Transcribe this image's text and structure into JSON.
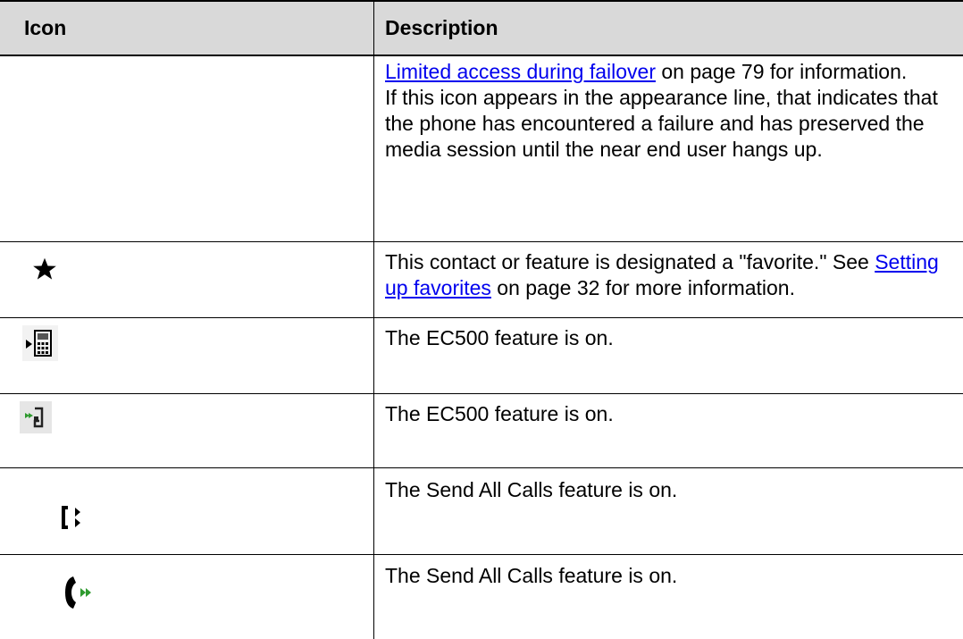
{
  "header": {
    "icon_col": "Icon",
    "description_col": "Description"
  },
  "rows": [
    {
      "link1_text": "Limited access during failover",
      "after_link1": " on page 79 for information.",
      "text2": "If this icon appears in the appearance line, that indicates that the phone has encountered a failure and has preserved the media session until the near end user hangs up."
    },
    {
      "before_link": "This contact or feature is designated a \"favorite.\" See ",
      "link_text": "Setting up favorites",
      "after_link": " on page 32 for more information.",
      "icon": "favorite-star-icon"
    },
    {
      "text": "The EC500 feature is on.",
      "icon": "ec500-cellphone-icon"
    },
    {
      "text": "The EC500 feature is on.",
      "icon": "ec500-small-icon"
    },
    {
      "text": "The Send All Calls feature is on.",
      "icon": "send-all-calls-bracket-icon"
    },
    {
      "text": "The Send All Calls feature is on.",
      "icon": "send-all-calls-handset-icon"
    }
  ]
}
